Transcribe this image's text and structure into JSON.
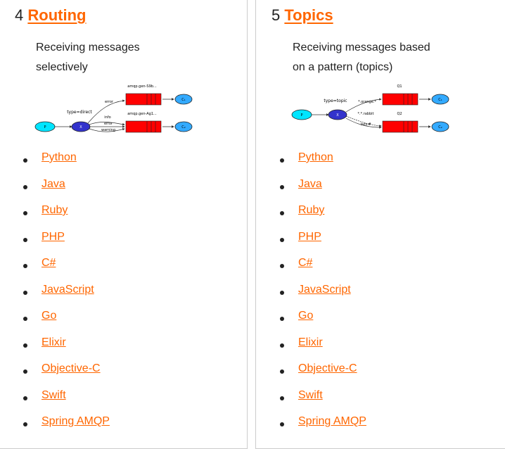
{
  "routing": {
    "number": "4",
    "title": "Routing",
    "description": "Receiving messages selectively",
    "diagram": {
      "producer": "P",
      "exchange": "X",
      "type_label": "type=direct",
      "queue1": "amqp.gen-S9b...",
      "queue2": "amqp.gen-Ag1...",
      "binding_error1": "error",
      "binding_info": "info",
      "binding_error2": "error",
      "binding_warning": "warning",
      "consumer1": "C₁",
      "consumer2": "C₂"
    },
    "links": [
      "Python",
      "Java",
      "Ruby",
      "PHP",
      "C#",
      "JavaScript",
      "Go",
      "Elixir",
      "Objective-C",
      "Swift",
      "Spring AMQP"
    ]
  },
  "topics": {
    "number": "5",
    "title": "Topics",
    "description": "Receiving messages based on a pattern (topics)",
    "diagram": {
      "producer": "P",
      "exchange": "X",
      "type_label": "type=topic",
      "queue1": "Q1",
      "queue2": "Q2",
      "binding_orange": "*.orange.*",
      "binding_rabbit": "*.*.rabbit",
      "binding_lazy": "lazy.#",
      "consumer1": "C₁",
      "consumer2": "C₂"
    },
    "links": [
      "Python",
      "Java",
      "Ruby",
      "PHP",
      "C#",
      "JavaScript",
      "Go",
      "Elixir",
      "Objective-C",
      "Swift",
      "Spring AMQP"
    ]
  },
  "colors": {
    "link": "#ff6600",
    "border": "#cccccc",
    "queue": "#ff0000",
    "producer": "#00e5ff",
    "exchange": "#3333cc",
    "consumer": "#33aaff"
  }
}
